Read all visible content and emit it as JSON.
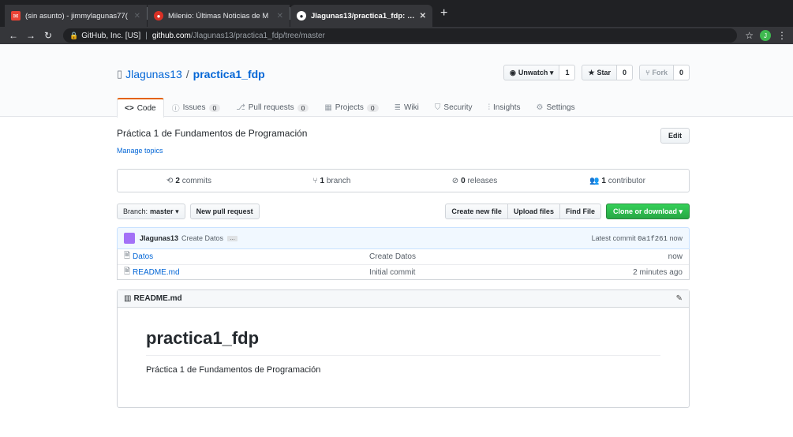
{
  "browser": {
    "tabs": [
      {
        "title": "(sin asunto) - jimmylagunas77(",
        "favicon": "gmail-icon"
      },
      {
        "title": "Milenio: Últimas Noticias de M",
        "favicon": "milenio-icon"
      },
      {
        "title": "Jlagunas13/practica1_fdp: Prác",
        "favicon": "github-icon"
      }
    ],
    "address": {
      "org": "GitHub, Inc. [US]",
      "host": "github.com",
      "path": "/Jlagunas13/practica1_fdp/tree/master"
    },
    "profile_initial": "J"
  },
  "repo": {
    "owner": "Jlagunas13",
    "slash": "/",
    "name": "practica1_fdp",
    "watch": {
      "label": "Unwatch",
      "count": "1"
    },
    "star": {
      "label": "Star",
      "count": "0"
    },
    "fork": {
      "label": "Fork",
      "count": "0"
    },
    "nav": [
      {
        "label": "Code",
        "icon": "<>"
      },
      {
        "label": "Issues",
        "count": "0",
        "icon": "ⓘ"
      },
      {
        "label": "Pull requests",
        "count": "0",
        "icon": "⎇"
      },
      {
        "label": "Projects",
        "count": "0",
        "icon": "▦"
      },
      {
        "label": "Wiki",
        "icon": "≣"
      },
      {
        "label": "Security",
        "icon": "⛉"
      },
      {
        "label": "Insights",
        "icon": "⫶"
      },
      {
        "label": "Settings",
        "icon": "⚙"
      }
    ],
    "description": "Práctica 1 de Fundamentos de Programación",
    "manage_topics": "Manage topics",
    "edit": "Edit",
    "summary": {
      "commits": {
        "count": "2",
        "label": "commits"
      },
      "branch": {
        "count": "1",
        "label": "branch"
      },
      "releases": {
        "count": "0",
        "label": "releases"
      },
      "contributors": {
        "count": "1",
        "label": "contributor"
      }
    },
    "branch_btn": {
      "prefix": "Branch:",
      "value": "master"
    },
    "new_pr": "New pull request",
    "create_file": "Create new file",
    "upload_files": "Upload files",
    "find_file": "Find File",
    "clone": "Clone or download",
    "commit": {
      "user": "Jlagunas13",
      "message": "Create Datos",
      "dots": "…",
      "latest_prefix": "Latest commit",
      "sha": "0a1f261",
      "when": "now"
    },
    "files": [
      {
        "name": "Datos",
        "message": "Create Datos",
        "age": "now"
      },
      {
        "name": "README.md",
        "message": "Initial commit",
        "age": "2 minutes ago"
      }
    ],
    "readme": {
      "file": "README.md",
      "heading": "practica1_fdp",
      "body": "Práctica 1 de Fundamentos de Programación"
    }
  }
}
